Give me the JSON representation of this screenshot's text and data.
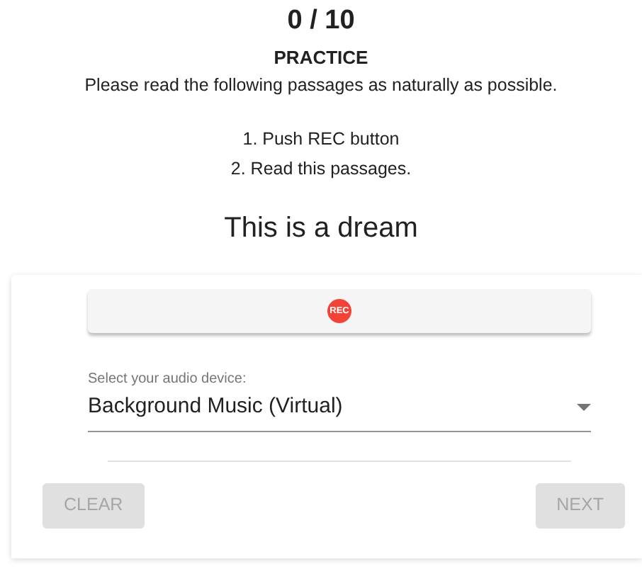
{
  "progress": "0 / 10",
  "title": "PRACTICE",
  "instruction": "Please read the following passages as naturally as possible.",
  "steps": [
    "1. Push REC button",
    "2. Read this passages."
  ],
  "passage": "This is a dream",
  "record_button": {
    "label": "REC"
  },
  "device_select": {
    "label": "Select your audio device:",
    "value": "Background Music (Virtual)"
  },
  "buttons": [
    {
      "label": "CLEAR",
      "disabled": true
    },
    {
      "label": "NEXT",
      "disabled": true
    }
  ]
}
